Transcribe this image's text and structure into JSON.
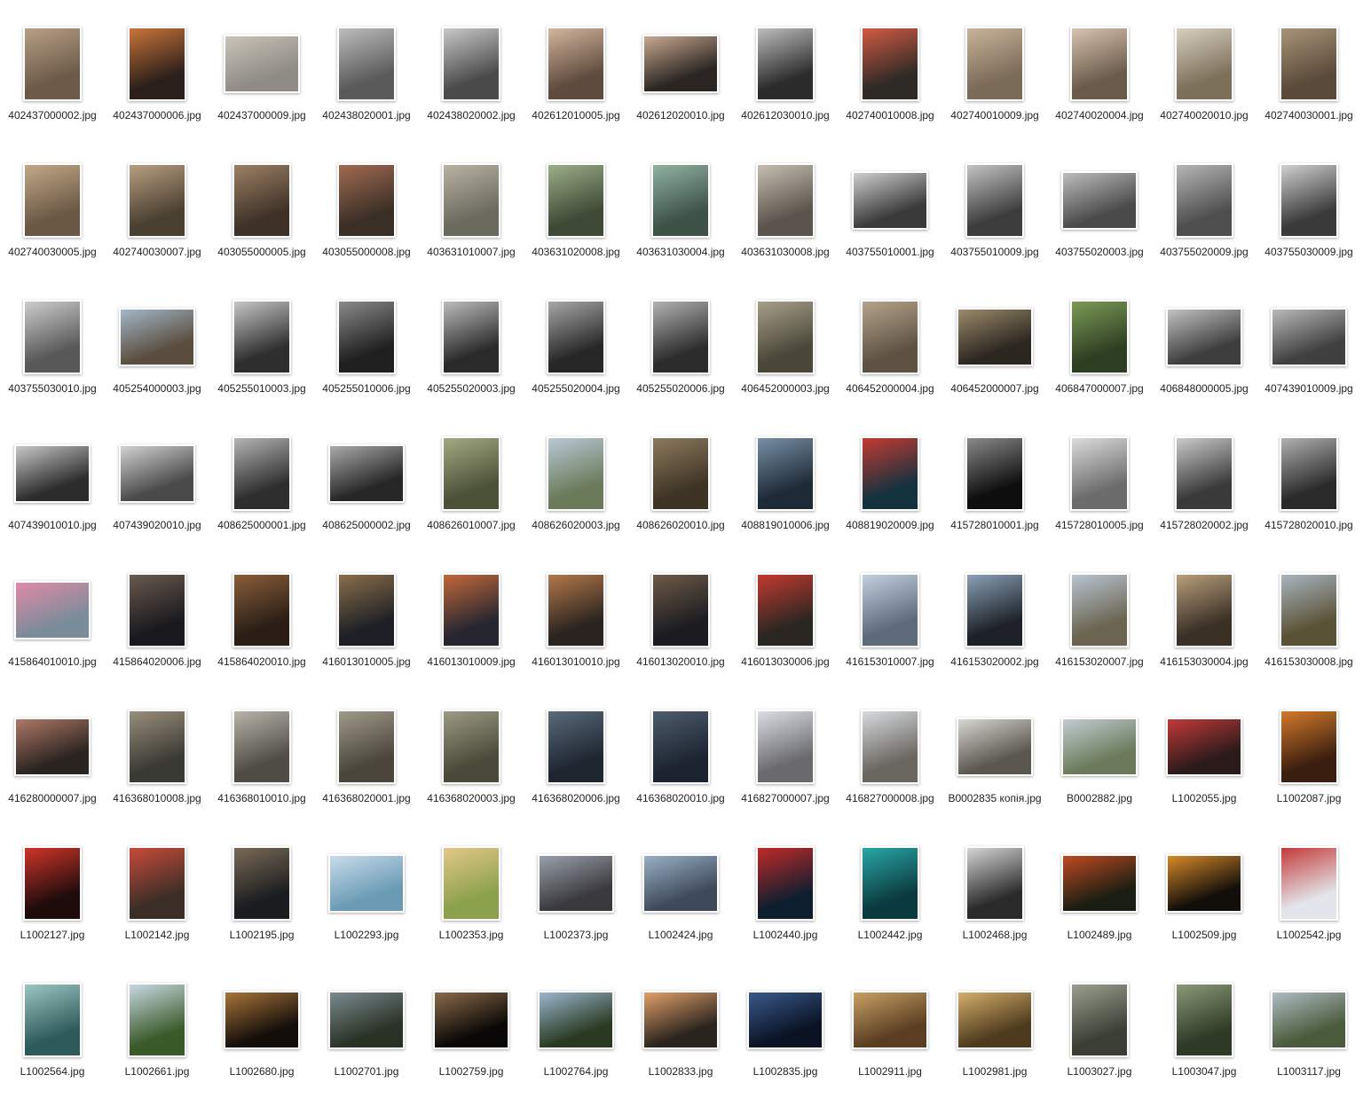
{
  "files": [
    {
      "name": "402437000002.jpg",
      "orientation": "portrait",
      "tone": "color",
      "colors": [
        "#6b5a48",
        "#b89f86"
      ]
    },
    {
      "name": "402437000006.jpg",
      "orientation": "portrait",
      "tone": "color",
      "colors": [
        "#2a1f1a",
        "#c9743a"
      ]
    },
    {
      "name": "402437000009.jpg",
      "orientation": "landscape",
      "tone": "color",
      "colors": [
        "#8f8c86",
        "#c9c3b7"
      ]
    },
    {
      "name": "402438020001.jpg",
      "orientation": "portrait",
      "tone": "bw",
      "colors": [
        "#5a5a5a",
        "#bdbdbd"
      ]
    },
    {
      "name": "402438020002.jpg",
      "orientation": "portrait",
      "tone": "bw",
      "colors": [
        "#4a4a4a",
        "#c8c8c8"
      ]
    },
    {
      "name": "402612010005.jpg",
      "orientation": "portrait",
      "tone": "color",
      "colors": [
        "#5e4a3e",
        "#d3b69c"
      ]
    },
    {
      "name": "402612020010.jpg",
      "orientation": "landscape",
      "tone": "color",
      "colors": [
        "#2a2522",
        "#c8a890"
      ]
    },
    {
      "name": "402612030010.jpg",
      "orientation": "portrait",
      "tone": "bw",
      "colors": [
        "#2b2b2b",
        "#bdbdbd"
      ]
    },
    {
      "name": "402740010008.jpg",
      "orientation": "portrait",
      "tone": "color",
      "colors": [
        "#2e2a26",
        "#d25a44"
      ]
    },
    {
      "name": "402740010009.jpg",
      "orientation": "portrait",
      "tone": "color",
      "colors": [
        "#7a6a58",
        "#c9b49a"
      ]
    },
    {
      "name": "402740020004.jpg",
      "orientation": "portrait",
      "tone": "color",
      "colors": [
        "#6a5a4a",
        "#d6c4b0"
      ]
    },
    {
      "name": "402740020010.jpg",
      "orientation": "portrait",
      "tone": "color",
      "colors": [
        "#7c705a",
        "#d8cfc0"
      ]
    },
    {
      "name": "402740030001.jpg",
      "orientation": "portrait",
      "tone": "color",
      "colors": [
        "#5a4a3a",
        "#a89478"
      ]
    },
    {
      "name": "402740030005.jpg",
      "orientation": "portrait",
      "tone": "color",
      "colors": [
        "#6a5844",
        "#c2a888"
      ]
    },
    {
      "name": "402740030007.jpg",
      "orientation": "portrait",
      "tone": "color",
      "colors": [
        "#4a4032",
        "#b89e80"
      ]
    },
    {
      "name": "403055000005.jpg",
      "orientation": "portrait",
      "tone": "color",
      "colors": [
        "#3e3228",
        "#9c8064"
      ]
    },
    {
      "name": "403055000008.jpg",
      "orientation": "portrait",
      "tone": "color",
      "colors": [
        "#3a2f26",
        "#a26a52"
      ]
    },
    {
      "name": "403631010007.jpg",
      "orientation": "portrait",
      "tone": "color",
      "colors": [
        "#6b6a5e",
        "#b8b3a4"
      ]
    },
    {
      "name": "403631020008.jpg",
      "orientation": "portrait",
      "tone": "color",
      "colors": [
        "#3e4a36",
        "#9cae88"
      ]
    },
    {
      "name": "403631030004.jpg",
      "orientation": "portrait",
      "tone": "color",
      "colors": [
        "#3f5248",
        "#8fb2a2"
      ]
    },
    {
      "name": "403631030008.jpg",
      "orientation": "portrait",
      "tone": "color",
      "colors": [
        "#5a544c",
        "#c7beb2"
      ]
    },
    {
      "name": "403755010001.jpg",
      "orientation": "landscape",
      "tone": "bw",
      "colors": [
        "#3a3a3a",
        "#cfcfcf"
      ]
    },
    {
      "name": "403755010009.jpg",
      "orientation": "portrait",
      "tone": "bw",
      "colors": [
        "#3c3c3c",
        "#c4c4c4"
      ]
    },
    {
      "name": "403755020003.jpg",
      "orientation": "landscape",
      "tone": "bw",
      "colors": [
        "#4a4a4a",
        "#bdbdbd"
      ]
    },
    {
      "name": "403755020009.jpg",
      "orientation": "portrait",
      "tone": "bw",
      "colors": [
        "#4e4e4e",
        "#b6b6b6"
      ]
    },
    {
      "name": "403755030009.jpg",
      "orientation": "portrait",
      "tone": "bw",
      "colors": [
        "#3a3a3a",
        "#d0d0d0"
      ]
    },
    {
      "name": "403755030010.jpg",
      "orientation": "portrait",
      "tone": "bw",
      "colors": [
        "#585858",
        "#cdcdcd"
      ]
    },
    {
      "name": "405254000003.jpg",
      "orientation": "landscape",
      "tone": "color",
      "colors": [
        "#5a4c3e",
        "#a3b7c8"
      ]
    },
    {
      "name": "405255010003.jpg",
      "orientation": "portrait",
      "tone": "bw",
      "colors": [
        "#2e2e2e",
        "#c6c6c6"
      ]
    },
    {
      "name": "405255010006.jpg",
      "orientation": "portrait",
      "tone": "bw",
      "colors": [
        "#1f1f1f",
        "#8a8a8a"
      ]
    },
    {
      "name": "405255020003.jpg",
      "orientation": "portrait",
      "tone": "bw",
      "colors": [
        "#2a2a2a",
        "#bcbcbc"
      ]
    },
    {
      "name": "405255020004.jpg",
      "orientation": "portrait",
      "tone": "bw",
      "colors": [
        "#262626",
        "#a8a8a8"
      ]
    },
    {
      "name": "405255020006.jpg",
      "orientation": "portrait",
      "tone": "bw",
      "colors": [
        "#2c2c2c",
        "#b2b2b2"
      ]
    },
    {
      "name": "406452000003.jpg",
      "orientation": "portrait",
      "tone": "color",
      "colors": [
        "#4a4638",
        "#a6a08a"
      ]
    },
    {
      "name": "406452000004.jpg",
      "orientation": "portrait",
      "tone": "color",
      "colors": [
        "#5e5244",
        "#b4a48c"
      ]
    },
    {
      "name": "406452000007.jpg",
      "orientation": "landscape",
      "tone": "color",
      "colors": [
        "#2a2620",
        "#9c8a6c"
      ]
    },
    {
      "name": "406847000007.jpg",
      "orientation": "portrait",
      "tone": "color",
      "colors": [
        "#2e3e22",
        "#7c9a58"
      ]
    },
    {
      "name": "406848000005.jpg",
      "orientation": "landscape",
      "tone": "bw",
      "colors": [
        "#3e3e3e",
        "#c2c2c2"
      ]
    },
    {
      "name": "407439010009.jpg",
      "orientation": "landscape",
      "tone": "bw",
      "colors": [
        "#404040",
        "#bababa"
      ]
    },
    {
      "name": "407439010010.jpg",
      "orientation": "landscape",
      "tone": "bw",
      "colors": [
        "#2c2c2c",
        "#c8c8c8"
      ]
    },
    {
      "name": "407439020010.jpg",
      "orientation": "landscape",
      "tone": "bw",
      "colors": [
        "#4a4a4a",
        "#d2d2d2"
      ]
    },
    {
      "name": "408625000001.jpg",
      "orientation": "portrait",
      "tone": "bw",
      "colors": [
        "#2e2e2e",
        "#b4b4b4"
      ]
    },
    {
      "name": "408625000002.jpg",
      "orientation": "landscape",
      "tone": "bw",
      "colors": [
        "#262626",
        "#aaaaaa"
      ]
    },
    {
      "name": "408626010007.jpg",
      "orientation": "portrait",
      "tone": "color",
      "colors": [
        "#4c5238",
        "#a4a882"
      ]
    },
    {
      "name": "408626020003.jpg",
      "orientation": "portrait",
      "tone": "color",
      "colors": [
        "#6a7a5a",
        "#b9c9d6"
      ]
    },
    {
      "name": "408626020010.jpg",
      "orientation": "portrait",
      "tone": "color",
      "colors": [
        "#3e3426",
        "#8c7a5c"
      ]
    },
    {
      "name": "408819010006.jpg",
      "orientation": "portrait",
      "tone": "color",
      "colors": [
        "#1e2a36",
        "#7890a6"
      ]
    },
    {
      "name": "408819020009.jpg",
      "orientation": "portrait",
      "tone": "color",
      "colors": [
        "#14323e",
        "#c43a32"
      ]
    },
    {
      "name": "415728010001.jpg",
      "orientation": "portrait",
      "tone": "bw",
      "colors": [
        "#0e0e0e",
        "#8a8a8a"
      ]
    },
    {
      "name": "415728010005.jpg",
      "orientation": "portrait",
      "tone": "bw",
      "colors": [
        "#6c6c6c",
        "#dcdcdc"
      ]
    },
    {
      "name": "415728020002.jpg",
      "orientation": "portrait",
      "tone": "bw",
      "colors": [
        "#3a3a3a",
        "#cacaca"
      ]
    },
    {
      "name": "415728020010.jpg",
      "orientation": "portrait",
      "tone": "bw",
      "colors": [
        "#2a2a2a",
        "#b0b0b0"
      ]
    },
    {
      "name": "415864010010.jpg",
      "orientation": "landscape",
      "tone": "color",
      "colors": [
        "#7a8c9a",
        "#e28aa6"
      ]
    },
    {
      "name": "415864020006.jpg",
      "orientation": "portrait",
      "tone": "color",
      "colors": [
        "#1a1a1e",
        "#6a5a4e"
      ]
    },
    {
      "name": "415864020010.jpg",
      "orientation": "portrait",
      "tone": "color",
      "colors": [
        "#2a1e16",
        "#8a5e3a"
      ]
    },
    {
      "name": "416013010005.jpg",
      "orientation": "portrait",
      "tone": "color",
      "colors": [
        "#1e2026",
        "#8a6e4a"
      ]
    },
    {
      "name": "416013010009.jpg",
      "orientation": "portrait",
      "tone": "color",
      "colors": [
        "#262630",
        "#c2683a"
      ]
    },
    {
      "name": "416013010010.jpg",
      "orientation": "portrait",
      "tone": "color",
      "colors": [
        "#2a2420",
        "#b4784a"
      ]
    },
    {
      "name": "416013020010.jpg",
      "orientation": "portrait",
      "tone": "color",
      "colors": [
        "#1c1c20",
        "#6e5a4a"
      ]
    },
    {
      "name": "416013030006.jpg",
      "orientation": "portrait",
      "tone": "color",
      "colors": [
        "#2a2622",
        "#c23a30"
      ]
    },
    {
      "name": "416153010007.jpg",
      "orientation": "portrait",
      "tone": "color",
      "colors": [
        "#5c6a7a",
        "#c2d0de"
      ]
    },
    {
      "name": "416153020002.jpg",
      "orientation": "portrait",
      "tone": "color",
      "colors": [
        "#1e2228",
        "#8aa0b6"
      ]
    },
    {
      "name": "416153020007.jpg",
      "orientation": "portrait",
      "tone": "color",
      "colors": [
        "#6a6450",
        "#b8c4d0"
      ]
    },
    {
      "name": "416153030004.jpg",
      "orientation": "portrait",
      "tone": "color",
      "colors": [
        "#3a3026",
        "#b89e7c"
      ]
    },
    {
      "name": "416153030008.jpg",
      "orientation": "portrait",
      "tone": "color",
      "colors": [
        "#5a5236",
        "#a8b4c0"
      ]
    },
    {
      "name": "416280000007.jpg",
      "orientation": "landscape",
      "tone": "color",
      "colors": [
        "#2a2420",
        "#b07868"
      ]
    },
    {
      "name": "416368010008.jpg",
      "orientation": "portrait",
      "tone": "color",
      "colors": [
        "#3a3a34",
        "#9a8e7c"
      ]
    },
    {
      "name": "416368010010.jpg",
      "orientation": "portrait",
      "tone": "color",
      "colors": [
        "#4e4c44",
        "#b8b4aa"
      ]
    },
    {
      "name": "416368020001.jpg",
      "orientation": "portrait",
      "tone": "color",
      "colors": [
        "#4a463c",
        "#a09a8a"
      ]
    },
    {
      "name": "416368020003.jpg",
      "orientation": "portrait",
      "tone": "color",
      "colors": [
        "#4a4a3a",
        "#9c9a84"
      ]
    },
    {
      "name": "416368020006.jpg",
      "orientation": "portrait",
      "tone": "color",
      "colors": [
        "#1e2630",
        "#5a6a7a"
      ]
    },
    {
      "name": "416368020010.jpg",
      "orientation": "portrait",
      "tone": "color",
      "colors": [
        "#1c2430",
        "#4e5c6c"
      ]
    },
    {
      "name": "416827000007.jpg",
      "orientation": "portrait",
      "tone": "color",
      "colors": [
        "#6a6a6e",
        "#dadee4"
      ]
    },
    {
      "name": "416827000008.jpg",
      "orientation": "portrait",
      "tone": "color",
      "colors": [
        "#6a6660",
        "#d6dade"
      ]
    },
    {
      "name": "B0002835 копія.jpg",
      "orientation": "landscape",
      "tone": "color",
      "colors": [
        "#5a5650",
        "#d8d6d0"
      ]
    },
    {
      "name": "B0002882.jpg",
      "orientation": "landscape",
      "tone": "color",
      "colors": [
        "#6a7a5a",
        "#c2ccd2"
      ]
    },
    {
      "name": "L1002055.jpg",
      "orientation": "landscape",
      "tone": "color",
      "colors": [
        "#2a1a1a",
        "#c23a3a"
      ]
    },
    {
      "name": "L1002087.jpg",
      "orientation": "portrait",
      "tone": "color",
      "colors": [
        "#3a1e10",
        "#d47a2a"
      ]
    },
    {
      "name": "L1002127.jpg",
      "orientation": "portrait",
      "tone": "color",
      "colors": [
        "#1e0c0c",
        "#d0342a"
      ]
    },
    {
      "name": "L1002142.jpg",
      "orientation": "portrait",
      "tone": "color",
      "colors": [
        "#3a2e26",
        "#c84a3a"
      ]
    },
    {
      "name": "L1002195.jpg",
      "orientation": "portrait",
      "tone": "color",
      "colors": [
        "#1a1c20",
        "#7a6a56"
      ]
    },
    {
      "name": "L1002293.jpg",
      "orientation": "landscape",
      "tone": "color",
      "colors": [
        "#6a9ab4",
        "#c8dcea"
      ]
    },
    {
      "name": "L1002353.jpg",
      "orientation": "portrait",
      "tone": "color",
      "colors": [
        "#8aa04a",
        "#e2c88a"
      ]
    },
    {
      "name": "L1002373.jpg",
      "orientation": "landscape",
      "tone": "color",
      "colors": [
        "#3a3a3e",
        "#9aa0aa"
      ]
    },
    {
      "name": "L1002424.jpg",
      "orientation": "landscape",
      "tone": "color",
      "colors": [
        "#3e4a5a",
        "#9ab0c6"
      ]
    },
    {
      "name": "L1002440.jpg",
      "orientation": "portrait",
      "tone": "color",
      "colors": [
        "#0e1e2e",
        "#c02a2a"
      ]
    },
    {
      "name": "L1002442.jpg",
      "orientation": "portrait",
      "tone": "color",
      "colors": [
        "#0a3a3e",
        "#2aa6a6"
      ]
    },
    {
      "name": "L1002468.jpg",
      "orientation": "portrait",
      "tone": "bw",
      "colors": [
        "#2a2a2a",
        "#d6d6d6"
      ]
    },
    {
      "name": "L1002489.jpg",
      "orientation": "landscape",
      "tone": "color",
      "colors": [
        "#1a1e12",
        "#c04a22"
      ]
    },
    {
      "name": "L1002509.jpg",
      "orientation": "landscape",
      "tone": "color",
      "colors": [
        "#120e0a",
        "#d68a2a"
      ]
    },
    {
      "name": "L1002542.jpg",
      "orientation": "portrait",
      "tone": "color",
      "colors": [
        "#e2e6ea",
        "#c43a3a"
      ]
    },
    {
      "name": "L1002564.jpg",
      "orientation": "portrait",
      "tone": "color",
      "colors": [
        "#2e5a5a",
        "#9cc6c2"
      ]
    },
    {
      "name": "L1002661.jpg",
      "orientation": "portrait",
      "tone": "color",
      "colors": [
        "#3a5a2a",
        "#c8d8e2"
      ]
    },
    {
      "name": "L1002680.jpg",
      "orientation": "landscape",
      "tone": "color",
      "colors": [
        "#140e0a",
        "#a8743a"
      ]
    },
    {
      "name": "L1002701.jpg",
      "orientation": "landscape",
      "tone": "color",
      "colors": [
        "#2a3226",
        "#7a8a8e"
      ]
    },
    {
      "name": "L1002759.jpg",
      "orientation": "landscape",
      "tone": "color",
      "colors": [
        "#0a0806",
        "#8a6a4a"
      ]
    },
    {
      "name": "L1002764.jpg",
      "orientation": "landscape",
      "tone": "color",
      "colors": [
        "#2a3a22",
        "#9ab6ce"
      ]
    },
    {
      "name": "L1002833.jpg",
      "orientation": "landscape",
      "tone": "color",
      "colors": [
        "#2a241e",
        "#e2a06a"
      ]
    },
    {
      "name": "L1002835.jpg",
      "orientation": "landscape",
      "tone": "color",
      "colors": [
        "#0a1224",
        "#3a5a8a"
      ]
    },
    {
      "name": "L1002911.jpg",
      "orientation": "landscape",
      "tone": "color",
      "colors": [
        "#5a3e22",
        "#c8a064"
      ]
    },
    {
      "name": "L1002981.jpg",
      "orientation": "landscape",
      "tone": "color",
      "colors": [
        "#4e3a1e",
        "#d4ae6a"
      ]
    },
    {
      "name": "L1003027.jpg",
      "orientation": "portrait",
      "tone": "color",
      "colors": [
        "#3a3e34",
        "#9aa090"
      ]
    },
    {
      "name": "L1003047.jpg",
      "orientation": "portrait",
      "tone": "color",
      "colors": [
        "#2e3a26",
        "#8a9a78"
      ]
    },
    {
      "name": "L1003117.jpg",
      "orientation": "landscape",
      "tone": "color",
      "colors": [
        "#4a5a3a",
        "#aebcc4"
      ]
    }
  ]
}
